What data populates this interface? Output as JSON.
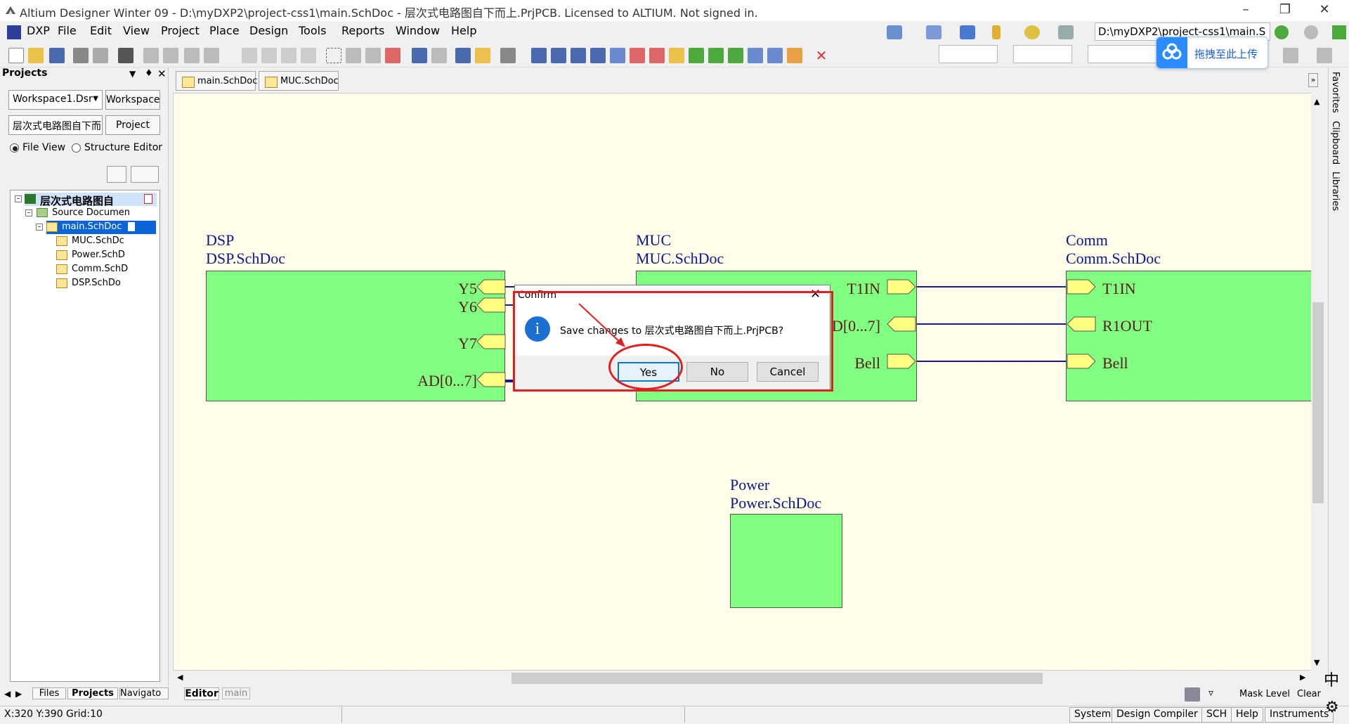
{
  "window": {
    "title": "Altium Designer Winter 09 - D:\\myDXP2\\project-css1\\main.SchDoc - 层次式电路图自下而上.PrjPCB. Licensed to ALTIUM. Not signed in."
  },
  "menubar": {
    "items": [
      "DXP",
      "File",
      "Edit",
      "View",
      "Project",
      "Place",
      "Design",
      "Tools",
      "Reports",
      "Window",
      "Help"
    ]
  },
  "toolbar": {
    "path_combo": "D:\\myDXP2\\project-css1\\main.S",
    "upload_button": "拖拽至此上传"
  },
  "projects_panel": {
    "title": "Projects",
    "workspace_combo": "Workspace1.Dsr",
    "workspace_button": "Workspace",
    "project_combo": "层次式电路图自下而",
    "project_button": "Project",
    "radio_file_view": "File View",
    "radio_structure_editor": "Structure Editor",
    "tree": {
      "project_name": "层次式电路图自",
      "folder": "Source Documen",
      "files": [
        "main.SchDoc",
        "MUC.SchDc",
        "Power.SchD",
        "Comm.SchD",
        "DSP.SchDo"
      ]
    },
    "bottom_tabs": [
      "Files",
      "Projects",
      "Navigato"
    ]
  },
  "doc_tabs": [
    "main.SchDoc",
    "MUC.SchDoc"
  ],
  "right_sidebar": [
    "Favorites",
    "Clipboard",
    "Libraries"
  ],
  "schematic": {
    "sheets": [
      {
        "name": "DSP",
        "file": "DSP.SchDoc",
        "ports": [
          "Y5",
          "Y6",
          "Y7",
          "AD[0...7]"
        ]
      },
      {
        "name": "MUC",
        "file": "MUC.SchDoc",
        "ports": [
          "T1IN",
          "D[0...7]",
          "Bell"
        ],
        "hidden_port": "Y5"
      },
      {
        "name": "Comm",
        "file": "Comm.SchDoc",
        "ports": [
          "T1IN",
          "R1OUT",
          "Bell"
        ]
      },
      {
        "name": "Power",
        "file": "Power.SchDoc",
        "ports": []
      }
    ]
  },
  "dialog": {
    "title": "Confirm",
    "message": "Save changes to 层次式电路图自下而上.PrjPCB?",
    "buttons": {
      "yes": "Yes",
      "no": "No",
      "cancel": "Cancel"
    }
  },
  "editor_tabs": [
    "Editor",
    "main"
  ],
  "bottom_right": {
    "mask_level": "Mask Level",
    "clear": "Clear",
    "ime": "中"
  },
  "status": {
    "coords": "X:320 Y:390",
    "grid": "Grid:10",
    "buttons": [
      "System",
      "Design Compiler",
      "SCH",
      "Help",
      "Instruments"
    ]
  },
  "colors": {
    "sheet_fill": "#80ff80",
    "canvas_bg": "#fffce9",
    "wire": "#1a1a8a",
    "port_fill": "#ffff80",
    "annotation_red": "#e02020",
    "selection_blue": "#0a64d8"
  }
}
